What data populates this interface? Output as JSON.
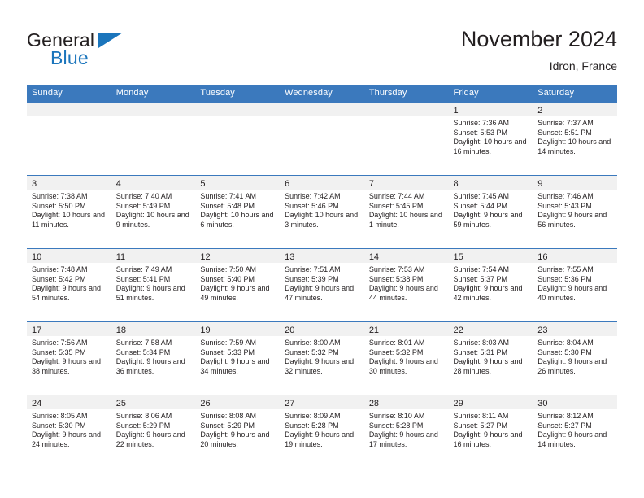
{
  "brand": {
    "line1": "General",
    "line2": "Blue",
    "accent_color": "#1b75bc",
    "flag_icon": "triangle-flag-icon"
  },
  "header": {
    "title": "November 2024",
    "location": "Idron, France"
  },
  "calendar": {
    "header_bg": "#3b79bd",
    "daynum_bg": "#f1f1f1",
    "weekdays": [
      "Sunday",
      "Monday",
      "Tuesday",
      "Wednesday",
      "Thursday",
      "Friday",
      "Saturday"
    ],
    "labels": {
      "sunrise": "Sunrise:",
      "sunset": "Sunset:",
      "daylight": "Daylight:"
    },
    "weeks": [
      [
        {
          "day": "",
          "sunrise": "",
          "sunset": "",
          "daylight": ""
        },
        {
          "day": "",
          "sunrise": "",
          "sunset": "",
          "daylight": ""
        },
        {
          "day": "",
          "sunrise": "",
          "sunset": "",
          "daylight": ""
        },
        {
          "day": "",
          "sunrise": "",
          "sunset": "",
          "daylight": ""
        },
        {
          "day": "",
          "sunrise": "",
          "sunset": "",
          "daylight": ""
        },
        {
          "day": "1",
          "sunrise": "Sunrise: 7:36 AM",
          "sunset": "Sunset: 5:53 PM",
          "daylight": "Daylight: 10 hours and 16 minutes."
        },
        {
          "day": "2",
          "sunrise": "Sunrise: 7:37 AM",
          "sunset": "Sunset: 5:51 PM",
          "daylight": "Daylight: 10 hours and 14 minutes."
        }
      ],
      [
        {
          "day": "3",
          "sunrise": "Sunrise: 7:38 AM",
          "sunset": "Sunset: 5:50 PM",
          "daylight": "Daylight: 10 hours and 11 minutes."
        },
        {
          "day": "4",
          "sunrise": "Sunrise: 7:40 AM",
          "sunset": "Sunset: 5:49 PM",
          "daylight": "Daylight: 10 hours and 9 minutes."
        },
        {
          "day": "5",
          "sunrise": "Sunrise: 7:41 AM",
          "sunset": "Sunset: 5:48 PM",
          "daylight": "Daylight: 10 hours and 6 minutes."
        },
        {
          "day": "6",
          "sunrise": "Sunrise: 7:42 AM",
          "sunset": "Sunset: 5:46 PM",
          "daylight": "Daylight: 10 hours and 3 minutes."
        },
        {
          "day": "7",
          "sunrise": "Sunrise: 7:44 AM",
          "sunset": "Sunset: 5:45 PM",
          "daylight": "Daylight: 10 hours and 1 minute."
        },
        {
          "day": "8",
          "sunrise": "Sunrise: 7:45 AM",
          "sunset": "Sunset: 5:44 PM",
          "daylight": "Daylight: 9 hours and 59 minutes."
        },
        {
          "day": "9",
          "sunrise": "Sunrise: 7:46 AM",
          "sunset": "Sunset: 5:43 PM",
          "daylight": "Daylight: 9 hours and 56 minutes."
        }
      ],
      [
        {
          "day": "10",
          "sunrise": "Sunrise: 7:48 AM",
          "sunset": "Sunset: 5:42 PM",
          "daylight": "Daylight: 9 hours and 54 minutes."
        },
        {
          "day": "11",
          "sunrise": "Sunrise: 7:49 AM",
          "sunset": "Sunset: 5:41 PM",
          "daylight": "Daylight: 9 hours and 51 minutes."
        },
        {
          "day": "12",
          "sunrise": "Sunrise: 7:50 AM",
          "sunset": "Sunset: 5:40 PM",
          "daylight": "Daylight: 9 hours and 49 minutes."
        },
        {
          "day": "13",
          "sunrise": "Sunrise: 7:51 AM",
          "sunset": "Sunset: 5:39 PM",
          "daylight": "Daylight: 9 hours and 47 minutes."
        },
        {
          "day": "14",
          "sunrise": "Sunrise: 7:53 AM",
          "sunset": "Sunset: 5:38 PM",
          "daylight": "Daylight: 9 hours and 44 minutes."
        },
        {
          "day": "15",
          "sunrise": "Sunrise: 7:54 AM",
          "sunset": "Sunset: 5:37 PM",
          "daylight": "Daylight: 9 hours and 42 minutes."
        },
        {
          "day": "16",
          "sunrise": "Sunrise: 7:55 AM",
          "sunset": "Sunset: 5:36 PM",
          "daylight": "Daylight: 9 hours and 40 minutes."
        }
      ],
      [
        {
          "day": "17",
          "sunrise": "Sunrise: 7:56 AM",
          "sunset": "Sunset: 5:35 PM",
          "daylight": "Daylight: 9 hours and 38 minutes."
        },
        {
          "day": "18",
          "sunrise": "Sunrise: 7:58 AM",
          "sunset": "Sunset: 5:34 PM",
          "daylight": "Daylight: 9 hours and 36 minutes."
        },
        {
          "day": "19",
          "sunrise": "Sunrise: 7:59 AM",
          "sunset": "Sunset: 5:33 PM",
          "daylight": "Daylight: 9 hours and 34 minutes."
        },
        {
          "day": "20",
          "sunrise": "Sunrise: 8:00 AM",
          "sunset": "Sunset: 5:32 PM",
          "daylight": "Daylight: 9 hours and 32 minutes."
        },
        {
          "day": "21",
          "sunrise": "Sunrise: 8:01 AM",
          "sunset": "Sunset: 5:32 PM",
          "daylight": "Daylight: 9 hours and 30 minutes."
        },
        {
          "day": "22",
          "sunrise": "Sunrise: 8:03 AM",
          "sunset": "Sunset: 5:31 PM",
          "daylight": "Daylight: 9 hours and 28 minutes."
        },
        {
          "day": "23",
          "sunrise": "Sunrise: 8:04 AM",
          "sunset": "Sunset: 5:30 PM",
          "daylight": "Daylight: 9 hours and 26 minutes."
        }
      ],
      [
        {
          "day": "24",
          "sunrise": "Sunrise: 8:05 AM",
          "sunset": "Sunset: 5:30 PM",
          "daylight": "Daylight: 9 hours and 24 minutes."
        },
        {
          "day": "25",
          "sunrise": "Sunrise: 8:06 AM",
          "sunset": "Sunset: 5:29 PM",
          "daylight": "Daylight: 9 hours and 22 minutes."
        },
        {
          "day": "26",
          "sunrise": "Sunrise: 8:08 AM",
          "sunset": "Sunset: 5:29 PM",
          "daylight": "Daylight: 9 hours and 20 minutes."
        },
        {
          "day": "27",
          "sunrise": "Sunrise: 8:09 AM",
          "sunset": "Sunset: 5:28 PM",
          "daylight": "Daylight: 9 hours and 19 minutes."
        },
        {
          "day": "28",
          "sunrise": "Sunrise: 8:10 AM",
          "sunset": "Sunset: 5:28 PM",
          "daylight": "Daylight: 9 hours and 17 minutes."
        },
        {
          "day": "29",
          "sunrise": "Sunrise: 8:11 AM",
          "sunset": "Sunset: 5:27 PM",
          "daylight": "Daylight: 9 hours and 16 minutes."
        },
        {
          "day": "30",
          "sunrise": "Sunrise: 8:12 AM",
          "sunset": "Sunset: 5:27 PM",
          "daylight": "Daylight: 9 hours and 14 minutes."
        }
      ]
    ]
  }
}
